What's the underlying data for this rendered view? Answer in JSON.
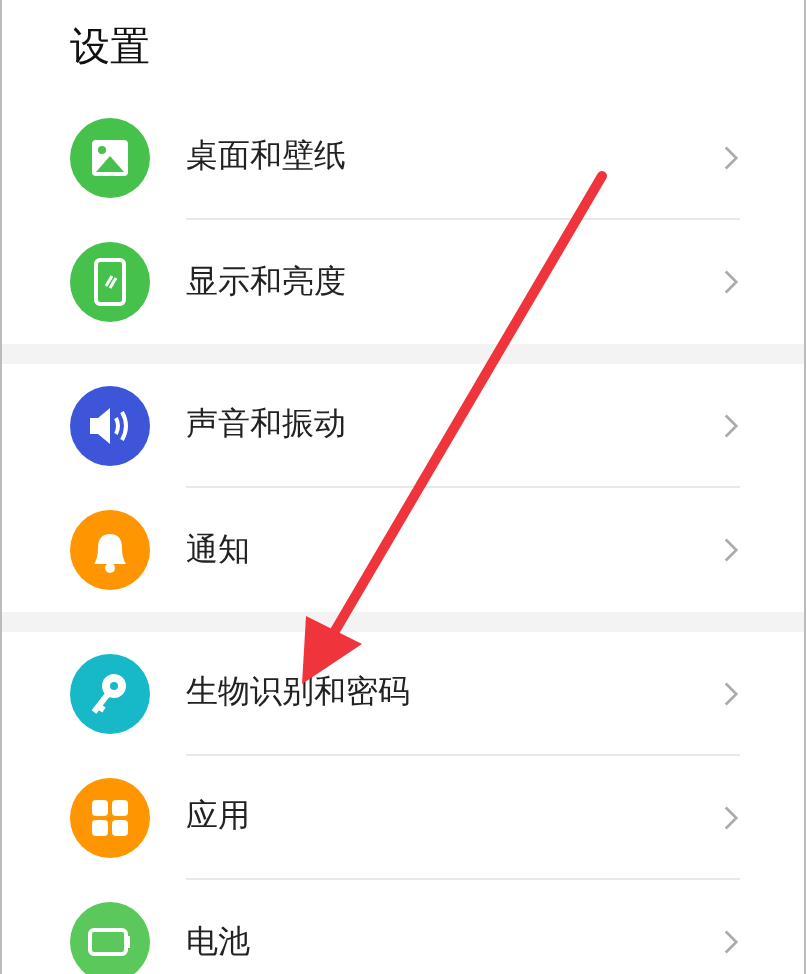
{
  "title": "设置",
  "groups": [
    {
      "items": [
        {
          "label": "桌面和壁纸",
          "kind": "picture",
          "color": "#45c14c"
        },
        {
          "label": "显示和亮度",
          "kind": "phone",
          "color": "#45c14c"
        }
      ]
    },
    {
      "items": [
        {
          "label": "声音和振动",
          "kind": "speaker",
          "color": "#3d55d9"
        },
        {
          "label": "通知",
          "kind": "bell",
          "color": "#ff9500"
        }
      ]
    },
    {
      "items": [
        {
          "label": "生物识别和密码",
          "kind": "key",
          "color": "#17b8c8"
        },
        {
          "label": "应用",
          "kind": "grid",
          "color": "#ff9500"
        },
        {
          "label": "电池",
          "kind": "battery",
          "color": "#5ac85a"
        }
      ]
    }
  ]
}
